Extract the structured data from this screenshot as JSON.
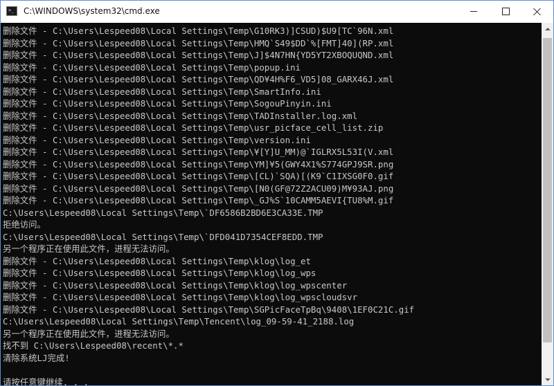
{
  "window": {
    "title": "C:\\WINDOWS\\system32\\cmd.exe"
  },
  "console": {
    "lines": [
      "删除文件 - C:\\Users\\Lespeed08\\Local Settings\\Temp\\G10RK3)]CSUD)$U9[TC`96N.xml",
      "删除文件 - C:\\Users\\Lespeed08\\Local Settings\\Temp\\HMQ`S49$DD`%[FMT]40](RP.xml",
      "删除文件 - C:\\Users\\Lespeed08\\Local Settings\\Temp\\J]$4N7HN{YD5YT2XBOQUQND.xml",
      "删除文件 - C:\\Users\\Lespeed08\\Local Settings\\Temp\\popup.ini",
      "删除文件 - C:\\Users\\Lespeed08\\Local Settings\\Temp\\QD¥4H%F6_VD5]08_GARX46J.xml",
      "删除文件 - C:\\Users\\Lespeed08\\Local Settings\\Temp\\SmartInfo.ini",
      "删除文件 - C:\\Users\\Lespeed08\\Local Settings\\Temp\\SogouPinyin.ini",
      "删除文件 - C:\\Users\\Lespeed08\\Local Settings\\Temp\\TADInstaller.log.xml",
      "删除文件 - C:\\Users\\Lespeed08\\Local Settings\\Temp\\usr_picface_cell_list.zip",
      "删除文件 - C:\\Users\\Lespeed08\\Local Settings\\Temp\\version.ini",
      "删除文件 - C:\\Users\\Lespeed08\\Local Settings\\Temp\\¥[Y]U_MM)@`IGLRX5L53I(V.xml",
      "删除文件 - C:\\Users\\Lespeed08\\Local Settings\\Temp\\YM]¥5(GWY4X1%S774GPJ9SR.png",
      "删除文件 - C:\\Users\\Lespeed08\\Local Settings\\Temp\\[CL)`SQA)[(K9`C1IXSG0F0.gif",
      "删除文件 - C:\\Users\\Lespeed08\\Local Settings\\Temp\\[N0(GF@72Z2ACU09)M¥93AJ.png",
      "删除文件 - C:\\Users\\Lespeed08\\Local Settings\\Temp\\_GJ%S`10CAMM5AEVI{TU8%M.gif",
      "C:\\Users\\Lespeed08\\Local Settings\\Temp\\`DF6586B2BD6E3CA33E.TMP",
      "拒绝访问。",
      "C:\\Users\\Lespeed08\\Local Settings\\Temp\\`DFD041D7354CEF8EDD.TMP",
      "另一个程序正在使用此文件，进程无法访问。",
      "删除文件 - C:\\Users\\Lespeed08\\Local Settings\\Temp\\klog\\log_et",
      "删除文件 - C:\\Users\\Lespeed08\\Local Settings\\Temp\\klog\\log_wps",
      "删除文件 - C:\\Users\\Lespeed08\\Local Settings\\Temp\\klog\\log_wpscenter",
      "删除文件 - C:\\Users\\Lespeed08\\Local Settings\\Temp\\klog\\log_wpscloudsvr",
      "删除文件 - C:\\Users\\Lespeed08\\Local Settings\\Temp\\SGPicFaceTpBq\\9408\\1EF0C21C.gif",
      "C:\\Users\\Lespeed08\\Local Settings\\Temp\\Tencent\\log_09-59-41_2188.log",
      "另一个程序正在使用此文件，进程无法访问。",
      "找不到 C:\\Users\\Lespeed08\\recent\\*.*",
      "清除系统LJ完成!",
      "",
      "请按任意键继续. . ."
    ]
  },
  "colors": {
    "console_bg": "#0c0c0c",
    "console_text": "#c7c7c7",
    "window_border": "#5a8fd0"
  },
  "icons": {
    "app": "cmd-console-icon",
    "minimize": "minimize-icon",
    "maximize": "maximize-icon",
    "close": "close-icon"
  }
}
